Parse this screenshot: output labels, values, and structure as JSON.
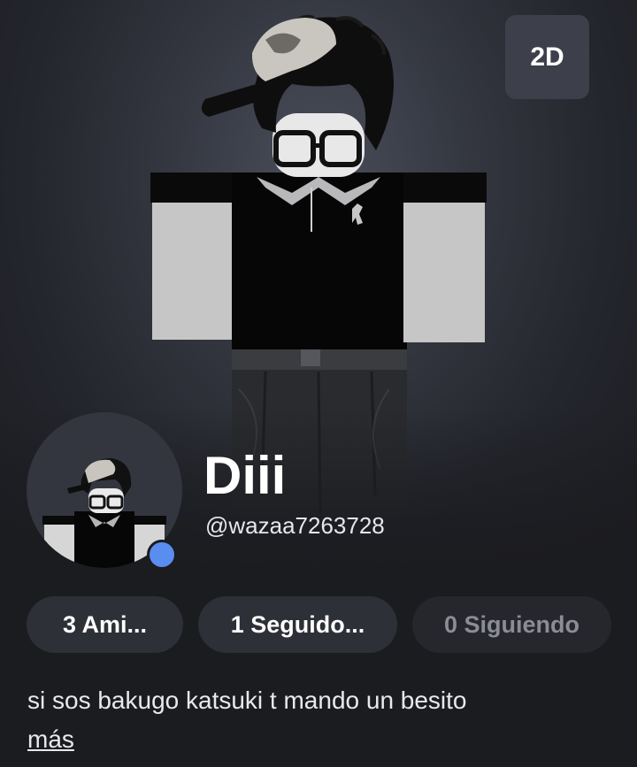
{
  "toggle": {
    "label": "2D"
  },
  "profile": {
    "display_name": "Diii",
    "username": "@wazaa7263728",
    "online": true,
    "status_color": "#5a8df0"
  },
  "stats": {
    "friends_label": "3 Ami...",
    "followers_label": "1 Seguido...",
    "following_label": "0 Siguiendo"
  },
  "about": {
    "bio": "si sos bakugo katsuki t mando un besito",
    "more_label": "más"
  },
  "colors": {
    "background": "#1b1c20",
    "pill": "#2e3037",
    "pill_muted_text": "#8b8d94"
  }
}
